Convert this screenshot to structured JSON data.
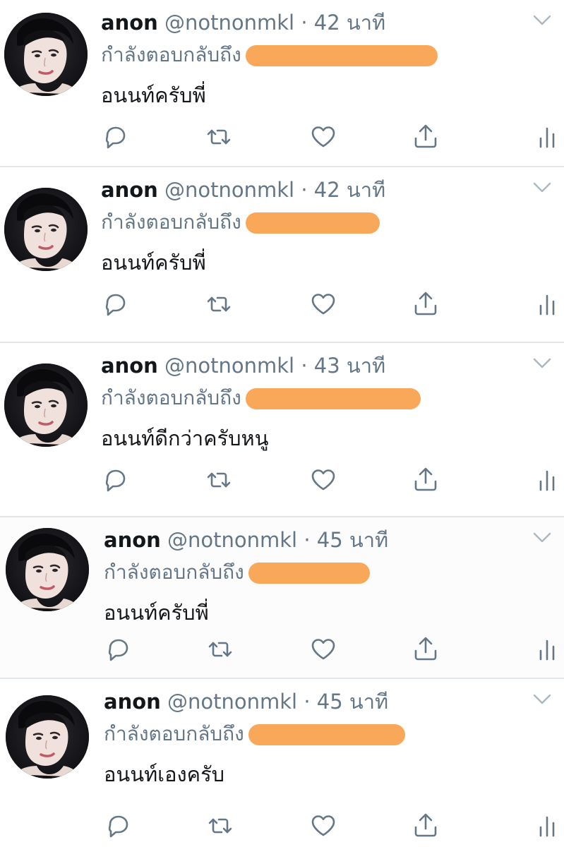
{
  "colors": {
    "name": "#14171a",
    "meta": "#657786",
    "redaction": "#f9a85a",
    "divider": "#e1e6ea"
  },
  "tweets": [
    {
      "name": "anon",
      "handle": "@notnonmkl",
      "separator": "·",
      "time": "42 นาที",
      "reply_prefix": "กำลังตอบกลับถึง",
      "text": "อนนท์ครับพี่"
    },
    {
      "name": "anon",
      "handle": "@notnonmkl",
      "separator": "·",
      "time": "42 นาที",
      "reply_prefix": "กำลังตอบกลับถึง",
      "text": "อนนท์ครับพี่"
    },
    {
      "name": "anon",
      "handle": "@notnonmkl",
      "separator": "·",
      "time": "43 นาที",
      "reply_prefix": "กำลังตอบกลับถึง",
      "text": "อนนท์ดีกว่าครับหนู"
    },
    {
      "name": "anon",
      "handle": "@notnonmkl",
      "separator": "·",
      "time": "45 นาที",
      "reply_prefix": "กำลังตอบกลับถึง",
      "text": "อนนท์ครับพี่"
    },
    {
      "name": "anon",
      "handle": "@notnonmkl",
      "separator": "·",
      "time": "45 นาที",
      "reply_prefix": "กำลังตอบกลับถึง",
      "text": "อนนท์เองครับ"
    }
  ],
  "icons": [
    "chevron-down-icon",
    "reply-icon",
    "retweet-icon",
    "like-icon",
    "share-icon",
    "stats-icon"
  ]
}
